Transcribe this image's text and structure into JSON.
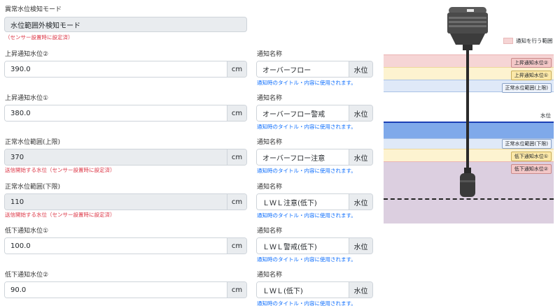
{
  "mode": {
    "label": "異常水位検知モード",
    "value": "水位範囲外検知モード",
    "hint": "（センサー設置時に設定済）"
  },
  "unit": "cm",
  "notify_unit": "水位",
  "rows": [
    {
      "level_label": "上昇通知水位②",
      "level_value": "390.0",
      "level_hint": "",
      "notify_label": "通知名称",
      "notify_value": "オーバーフロー",
      "notify_hint": "通知時のタイトル・内容に使用されます。"
    },
    {
      "level_label": "上昇通知水位①",
      "level_value": "380.0",
      "level_hint": "",
      "notify_label": "通知名称",
      "notify_value": "オーバーフロー警戒",
      "notify_hint": "通知時のタイトル・内容に使用されます。"
    },
    {
      "level_label": "正常水位範囲(上限)",
      "level_value": "370",
      "level_hint": "送信開始する水位（センサー設置時に設定済）",
      "notify_label": "通知名称",
      "notify_value": "オーバーフロー注意",
      "notify_hint": "通知時のタイトル・内容に使用されます。"
    },
    {
      "level_label": "正常水位範囲(下限)",
      "level_value": "110",
      "level_hint": "送信開始する水位（センサー設置時に設定済）",
      "notify_label": "通知名称",
      "notify_value": "ＬＷＬ注意(低下)",
      "notify_hint": "通知時のタイトル・内容に使用されます。"
    },
    {
      "level_label": "低下通知水位①",
      "level_value": "100.0",
      "level_hint": "",
      "notify_label": "通知名称",
      "notify_value": "ＬＷＬ警戒(低下)",
      "notify_hint": "通知時のタイトル・内容に使用されます。"
    },
    {
      "level_label": "低下通知水位②",
      "level_value": "90.0",
      "level_hint": "",
      "notify_label": "通知名称",
      "notify_value": "ＬＷＬ(低下)",
      "notify_hint": "通知時のタイトル・内容に使用されます。"
    }
  ],
  "diagram": {
    "legend": "通知を行う範囲",
    "water_level": "水位",
    "tags": {
      "rise2": "上昇通知水位②",
      "rise1": "上昇通知水位①",
      "normal_upper": "正常水位範囲(上限)",
      "normal_lower": "正常水位範囲(下限)",
      "low1": "低下通知水位①",
      "low2": "低下通知水位②"
    },
    "colors": {
      "notify_red": "#f6d5d5",
      "notify_yellow": "#fdf3d0",
      "normal_blue": "#dfe9f8",
      "water_blue": "#7fa9ea",
      "water_line": "#1a3fb5",
      "bottom_purple": "#dccfe0"
    }
  }
}
